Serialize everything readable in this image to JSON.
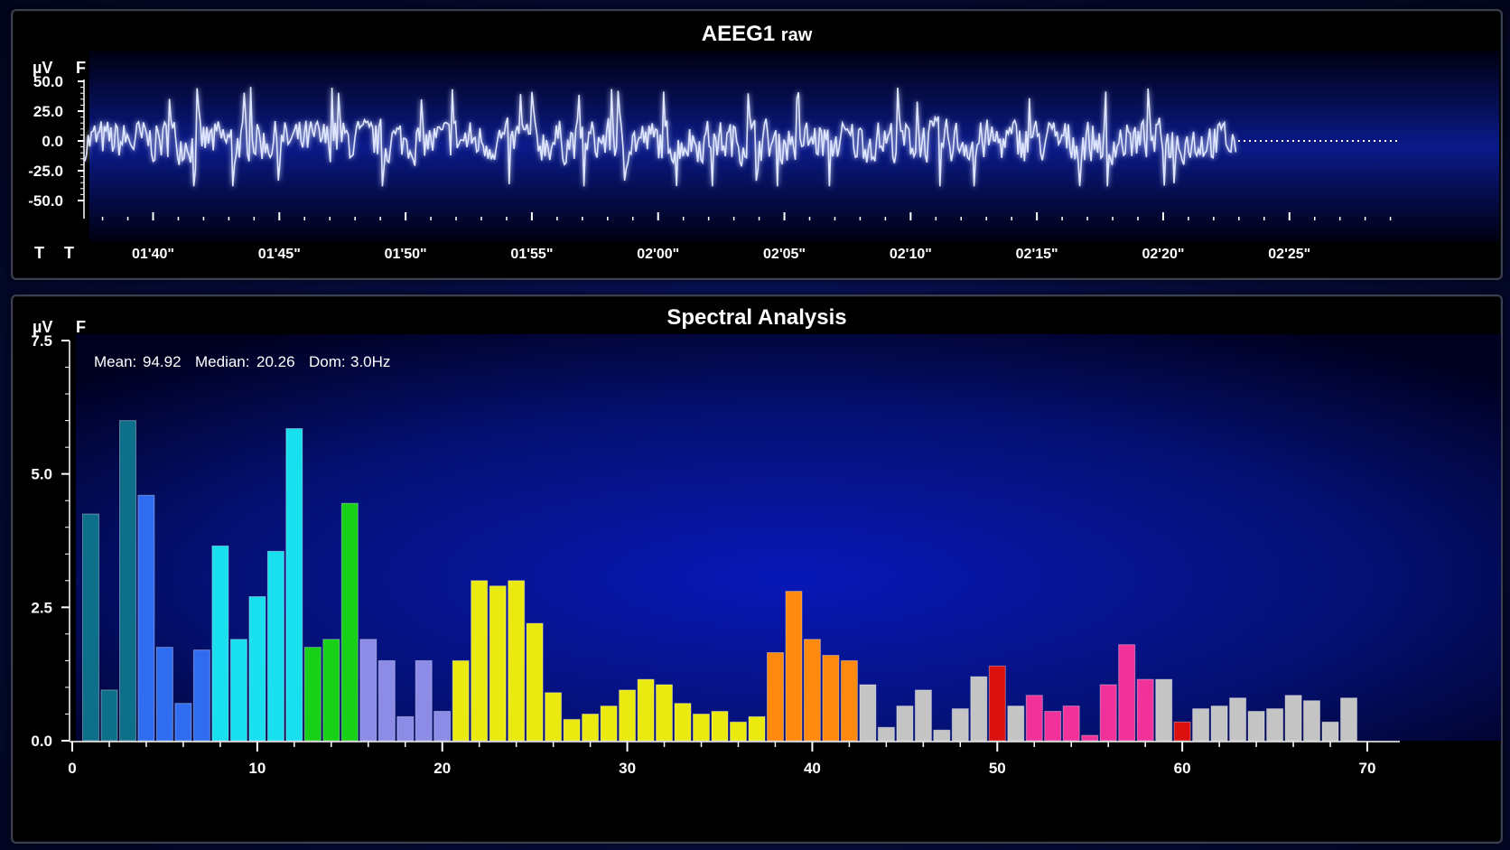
{
  "raw_panel": {
    "title": "AEEG1",
    "title_suffix": "raw",
    "unit_label": "µV",
    "f_label": "F",
    "bottom_left_labels": [
      "T",
      "T"
    ],
    "y_ticks": [
      "50.0",
      "25.0",
      "0.0",
      "-25.0",
      "-50.0"
    ],
    "x_ticks": [
      "01'40\"",
      "01'45\"",
      "01'50\"",
      "01'55\"",
      "02'00\"",
      "02'05\"",
      "02'10\"",
      "02'15\"",
      "02'20\"",
      "02'25\""
    ]
  },
  "spectral_panel": {
    "title": "Spectral Analysis",
    "unit_label": "µV",
    "f_label": "F",
    "stats": {
      "mean_label": "Mean:",
      "mean": "94.92",
      "median_label": "Median:",
      "median": "20.26",
      "dom_label": "Dom:",
      "dom": "3.0Hz"
    }
  },
  "chart_data": [
    {
      "type": "line",
      "title": "AEEG1 raw",
      "ylabel": "µV",
      "ylim": [
        -60,
        60
      ],
      "x_tick_labels": [
        "01'40\"",
        "01'45\"",
        "01'50\"",
        "01'55\"",
        "02'00\"",
        "02'05\"",
        "02'10\"",
        "02'15\"",
        "02'20\"",
        "02'25\""
      ],
      "x_tick_seconds": [
        100,
        105,
        110,
        115,
        120,
        125,
        130,
        135,
        140,
        145
      ],
      "xlim_seconds": [
        97.3,
        149.3
      ],
      "signal_end_seconds": 142.9,
      "color": "#7d8cff"
    },
    {
      "type": "bar",
      "title": "Spectral Analysis",
      "ylabel": "µV",
      "ylim": [
        0,
        7.5
      ],
      "xlim": [
        0,
        70
      ],
      "x_ticks": [
        0,
        10,
        20,
        30,
        40,
        50,
        60,
        70
      ],
      "y_ticks": [
        0.0,
        2.5,
        5.0,
        7.5
      ],
      "grid": false,
      "x": [
        1,
        2,
        3,
        4,
        5,
        6,
        7,
        8,
        9,
        10,
        11,
        12,
        13,
        14,
        15,
        16,
        17,
        18,
        19,
        20,
        21,
        22,
        23,
        24,
        25,
        26,
        27,
        28,
        29,
        30,
        31,
        32,
        33,
        34,
        35,
        36,
        37,
        38,
        39,
        40,
        41,
        42,
        43,
        44,
        45,
        46,
        47,
        48,
        49,
        50,
        51,
        52,
        53,
        54,
        55,
        56,
        57,
        58,
        59,
        60,
        61,
        62,
        63,
        64,
        65,
        66,
        67,
        68,
        69
      ],
      "values": [
        4.25,
        0.95,
        6.0,
        4.6,
        1.75,
        0.7,
        1.7,
        3.65,
        1.9,
        2.7,
        3.55,
        5.85,
        1.75,
        1.9,
        4.45,
        1.9,
        1.5,
        0.45,
        1.5,
        0.55,
        1.5,
        3.0,
        2.9,
        3.0,
        2.2,
        0.9,
        0.4,
        0.5,
        0.65,
        0.95,
        1.15,
        1.05,
        0.7,
        0.5,
        0.55,
        0.35,
        0.45,
        1.65,
        2.8,
        1.9,
        1.6,
        1.5,
        1.05,
        0.25,
        0.65,
        0.95,
        0.2,
        0.6,
        1.2,
        1.4,
        0.65,
        0.85,
        0.55,
        0.65,
        0.1,
        1.05,
        1.8,
        1.15,
        1.15,
        0.35,
        0.6,
        0.65,
        0.8,
        0.55,
        0.6,
        0.85,
        0.75,
        0.35,
        0.8
      ],
      "colors": [
        "#0e6f8a",
        "#0e6f8a",
        "#0e6f8a",
        "#2f6cf0",
        "#2f6cf0",
        "#2f6cf0",
        "#2f6cf0",
        "#19e0ef",
        "#19e0ef",
        "#19e0ef",
        "#19e0ef",
        "#19e0ef",
        "#18d018",
        "#18d018",
        "#18d018",
        "#8c8ce6",
        "#8c8ce6",
        "#8c8ce6",
        "#8c8ce6",
        "#8c8ce6",
        "#eaea10",
        "#eaea10",
        "#eaea10",
        "#eaea10",
        "#eaea10",
        "#eaea10",
        "#eaea10",
        "#eaea10",
        "#eaea10",
        "#eaea10",
        "#eaea10",
        "#eaea10",
        "#eaea10",
        "#eaea10",
        "#eaea10",
        "#eaea10",
        "#eaea10",
        "#ff8a0e",
        "#ff8a0e",
        "#ff8a0e",
        "#ff8a0e",
        "#ff8a0e",
        "#c4c4c4",
        "#c4c4c4",
        "#c4c4c4",
        "#c4c4c4",
        "#c4c4c4",
        "#c4c4c4",
        "#c4c4c4",
        "#dd1010",
        "#c4c4c4",
        "#f0329a",
        "#f0329a",
        "#f0329a",
        "#f0329a",
        "#f0329a",
        "#f0329a",
        "#f0329a",
        "#c4c4c4",
        "#dd1010",
        "#c4c4c4",
        "#c4c4c4",
        "#c4c4c4",
        "#c4c4c4",
        "#c4c4c4",
        "#c4c4c4",
        "#c4c4c4",
        "#c4c4c4",
        "#c4c4c4"
      ]
    }
  ]
}
